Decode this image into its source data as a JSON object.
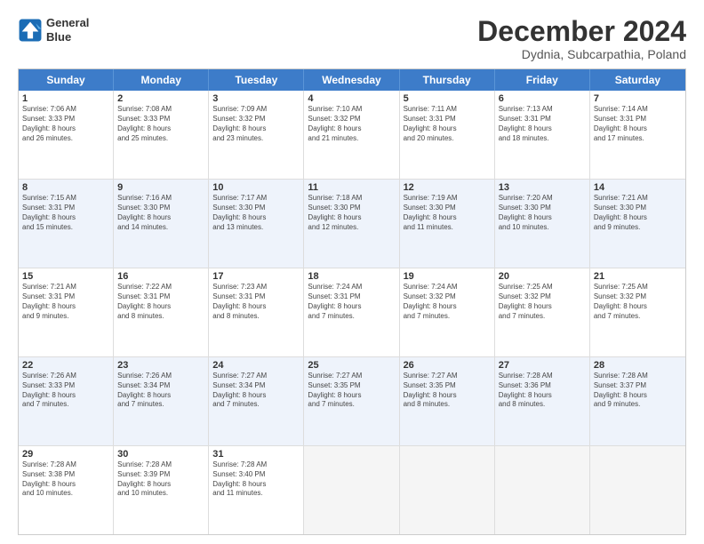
{
  "logo": {
    "text_line1": "General",
    "text_line2": "Blue"
  },
  "title": "December 2024",
  "subtitle": "Dydnia, Subcarpathia, Poland",
  "header_days": [
    "Sunday",
    "Monday",
    "Tuesday",
    "Wednesday",
    "Thursday",
    "Friday",
    "Saturday"
  ],
  "weeks": [
    {
      "alt": false,
      "cells": [
        {
          "day": "1",
          "lines": [
            "Sunrise: 7:06 AM",
            "Sunset: 3:33 PM",
            "Daylight: 8 hours",
            "and 26 minutes."
          ]
        },
        {
          "day": "2",
          "lines": [
            "Sunrise: 7:08 AM",
            "Sunset: 3:33 PM",
            "Daylight: 8 hours",
            "and 25 minutes."
          ]
        },
        {
          "day": "3",
          "lines": [
            "Sunrise: 7:09 AM",
            "Sunset: 3:32 PM",
            "Daylight: 8 hours",
            "and 23 minutes."
          ]
        },
        {
          "day": "4",
          "lines": [
            "Sunrise: 7:10 AM",
            "Sunset: 3:32 PM",
            "Daylight: 8 hours",
            "and 21 minutes."
          ]
        },
        {
          "day": "5",
          "lines": [
            "Sunrise: 7:11 AM",
            "Sunset: 3:31 PM",
            "Daylight: 8 hours",
            "and 20 minutes."
          ]
        },
        {
          "day": "6",
          "lines": [
            "Sunrise: 7:13 AM",
            "Sunset: 3:31 PM",
            "Daylight: 8 hours",
            "and 18 minutes."
          ]
        },
        {
          "day": "7",
          "lines": [
            "Sunrise: 7:14 AM",
            "Sunset: 3:31 PM",
            "Daylight: 8 hours",
            "and 17 minutes."
          ]
        }
      ]
    },
    {
      "alt": true,
      "cells": [
        {
          "day": "8",
          "lines": [
            "Sunrise: 7:15 AM",
            "Sunset: 3:31 PM",
            "Daylight: 8 hours",
            "and 15 minutes."
          ]
        },
        {
          "day": "9",
          "lines": [
            "Sunrise: 7:16 AM",
            "Sunset: 3:30 PM",
            "Daylight: 8 hours",
            "and 14 minutes."
          ]
        },
        {
          "day": "10",
          "lines": [
            "Sunrise: 7:17 AM",
            "Sunset: 3:30 PM",
            "Daylight: 8 hours",
            "and 13 minutes."
          ]
        },
        {
          "day": "11",
          "lines": [
            "Sunrise: 7:18 AM",
            "Sunset: 3:30 PM",
            "Daylight: 8 hours",
            "and 12 minutes."
          ]
        },
        {
          "day": "12",
          "lines": [
            "Sunrise: 7:19 AM",
            "Sunset: 3:30 PM",
            "Daylight: 8 hours",
            "and 11 minutes."
          ]
        },
        {
          "day": "13",
          "lines": [
            "Sunrise: 7:20 AM",
            "Sunset: 3:30 PM",
            "Daylight: 8 hours",
            "and 10 minutes."
          ]
        },
        {
          "day": "14",
          "lines": [
            "Sunrise: 7:21 AM",
            "Sunset: 3:30 PM",
            "Daylight: 8 hours",
            "and 9 minutes."
          ]
        }
      ]
    },
    {
      "alt": false,
      "cells": [
        {
          "day": "15",
          "lines": [
            "Sunrise: 7:21 AM",
            "Sunset: 3:31 PM",
            "Daylight: 8 hours",
            "and 9 minutes."
          ]
        },
        {
          "day": "16",
          "lines": [
            "Sunrise: 7:22 AM",
            "Sunset: 3:31 PM",
            "Daylight: 8 hours",
            "and 8 minutes."
          ]
        },
        {
          "day": "17",
          "lines": [
            "Sunrise: 7:23 AM",
            "Sunset: 3:31 PM",
            "Daylight: 8 hours",
            "and 8 minutes."
          ]
        },
        {
          "day": "18",
          "lines": [
            "Sunrise: 7:24 AM",
            "Sunset: 3:31 PM",
            "Daylight: 8 hours",
            "and 7 minutes."
          ]
        },
        {
          "day": "19",
          "lines": [
            "Sunrise: 7:24 AM",
            "Sunset: 3:32 PM",
            "Daylight: 8 hours",
            "and 7 minutes."
          ]
        },
        {
          "day": "20",
          "lines": [
            "Sunrise: 7:25 AM",
            "Sunset: 3:32 PM",
            "Daylight: 8 hours",
            "and 7 minutes."
          ]
        },
        {
          "day": "21",
          "lines": [
            "Sunrise: 7:25 AM",
            "Sunset: 3:32 PM",
            "Daylight: 8 hours",
            "and 7 minutes."
          ]
        }
      ]
    },
    {
      "alt": true,
      "cells": [
        {
          "day": "22",
          "lines": [
            "Sunrise: 7:26 AM",
            "Sunset: 3:33 PM",
            "Daylight: 8 hours",
            "and 7 minutes."
          ]
        },
        {
          "day": "23",
          "lines": [
            "Sunrise: 7:26 AM",
            "Sunset: 3:34 PM",
            "Daylight: 8 hours",
            "and 7 minutes."
          ]
        },
        {
          "day": "24",
          "lines": [
            "Sunrise: 7:27 AM",
            "Sunset: 3:34 PM",
            "Daylight: 8 hours",
            "and 7 minutes."
          ]
        },
        {
          "day": "25",
          "lines": [
            "Sunrise: 7:27 AM",
            "Sunset: 3:35 PM",
            "Daylight: 8 hours",
            "and 7 minutes."
          ]
        },
        {
          "day": "26",
          "lines": [
            "Sunrise: 7:27 AM",
            "Sunset: 3:35 PM",
            "Daylight: 8 hours",
            "and 8 minutes."
          ]
        },
        {
          "day": "27",
          "lines": [
            "Sunrise: 7:28 AM",
            "Sunset: 3:36 PM",
            "Daylight: 8 hours",
            "and 8 minutes."
          ]
        },
        {
          "day": "28",
          "lines": [
            "Sunrise: 7:28 AM",
            "Sunset: 3:37 PM",
            "Daylight: 8 hours",
            "and 9 minutes."
          ]
        }
      ]
    },
    {
      "alt": false,
      "cells": [
        {
          "day": "29",
          "lines": [
            "Sunrise: 7:28 AM",
            "Sunset: 3:38 PM",
            "Daylight: 8 hours",
            "and 10 minutes."
          ]
        },
        {
          "day": "30",
          "lines": [
            "Sunrise: 7:28 AM",
            "Sunset: 3:39 PM",
            "Daylight: 8 hours",
            "and 10 minutes."
          ]
        },
        {
          "day": "31",
          "lines": [
            "Sunrise: 7:28 AM",
            "Sunset: 3:40 PM",
            "Daylight: 8 hours",
            "and 11 minutes."
          ]
        },
        {
          "day": "",
          "lines": []
        },
        {
          "day": "",
          "lines": []
        },
        {
          "day": "",
          "lines": []
        },
        {
          "day": "",
          "lines": []
        }
      ]
    }
  ]
}
